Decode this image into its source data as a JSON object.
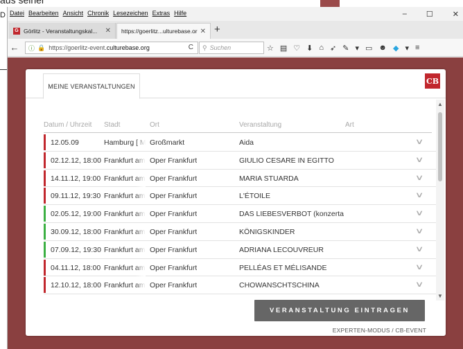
{
  "background": {
    "text_top": "aus seiner",
    "letter": "D"
  },
  "browser": {
    "menu": [
      "Datei",
      "Bearbeiten",
      "Ansicht",
      "Chronik",
      "Lesezeichen",
      "Extras",
      "Hilfe"
    ],
    "window_controls": {
      "minimize": "–",
      "maximize": "☐",
      "close": "✕"
    },
    "tabs": [
      {
        "label": "Görlitz - Veranstaltungskal...",
        "favicon": "G",
        "close": "✕"
      },
      {
        "label": "https://goerlitz...ulturebase.org/",
        "close": "✕"
      }
    ],
    "new_tab": "+",
    "url": {
      "prefix": "https://goerlitz-event.",
      "host": "culturebase.org",
      "reload": "C"
    },
    "search_placeholder": "Suchen",
    "back_icon": "←",
    "toolbar_icons": [
      "☆",
      "▤",
      "♡",
      "⬇",
      "⌂",
      "➶",
      "✎",
      "▾",
      "▭",
      "☻",
      "◆",
      "▾",
      "≡"
    ]
  },
  "app": {
    "tab_label": "MEINE VERANSTALTUNGEN",
    "logo": "CB",
    "columns": {
      "datum": "Datum / Uhrzeit",
      "stadt": "Stadt",
      "ort": "Ort",
      "veranstaltung": "Veranstaltung",
      "art": "Art"
    },
    "rows": [
      {
        "datum": "12.05.09",
        "stadt": "Hamburg [ Mo",
        "ort": "Großmarkt",
        "veranstaltung": "Aida",
        "status_color": "#c1272d"
      },
      {
        "datum": "02.12.12, 18:00",
        "stadt": "Frankfurt am",
        "ort": "Oper Frankfurt",
        "veranstaltung": "GIULIO CESARE IN EGITTO",
        "status_color": "#c1272d"
      },
      {
        "datum": "14.11.12, 19:00",
        "stadt": "Frankfurt am",
        "ort": "Oper Frankfurt",
        "veranstaltung": "MARIA STUARDA",
        "status_color": "#c1272d"
      },
      {
        "datum": "09.11.12, 19:30",
        "stadt": "Frankfurt am",
        "ort": "Oper Frankfurt",
        "veranstaltung": "L'ÉTOILE",
        "status_color": "#c1272d"
      },
      {
        "datum": "02.05.12, 19:00",
        "stadt": "Frankfurt am",
        "ort": "Oper Frankfurt",
        "veranstaltung": "DAS LIEBESVERBOT (konzerta",
        "status_color": "#3cb043"
      },
      {
        "datum": "30.09.12, 18:00",
        "stadt": "Frankfurt am",
        "ort": "Oper Frankfurt",
        "veranstaltung": "KÖNIGSKINDER",
        "status_color": "#3cb043"
      },
      {
        "datum": "07.09.12, 19:30",
        "stadt": "Frankfurt am",
        "ort": "Oper Frankfurt",
        "veranstaltung": "ADRIANA LECOUVREUR",
        "status_color": "#3cb043"
      },
      {
        "datum": "04.11.12, 18:00",
        "stadt": "Frankfurt am",
        "ort": "Oper Frankfurt",
        "veranstaltung": "PELLÉAS ET MÉLISANDE",
        "status_color": "#c1272d"
      },
      {
        "datum": "12.10.12, 18:00",
        "stadt": "Frankfurt am",
        "ort": "Oper Frankfurt",
        "veranstaltung": "CHOWANSCHTSCHINA",
        "status_color": "#c1272d"
      }
    ],
    "add_button": "VERANSTALTUNG EINTRAGEN",
    "expert_link": "EXPERTEN-MODUS / CB-EVENT"
  }
}
